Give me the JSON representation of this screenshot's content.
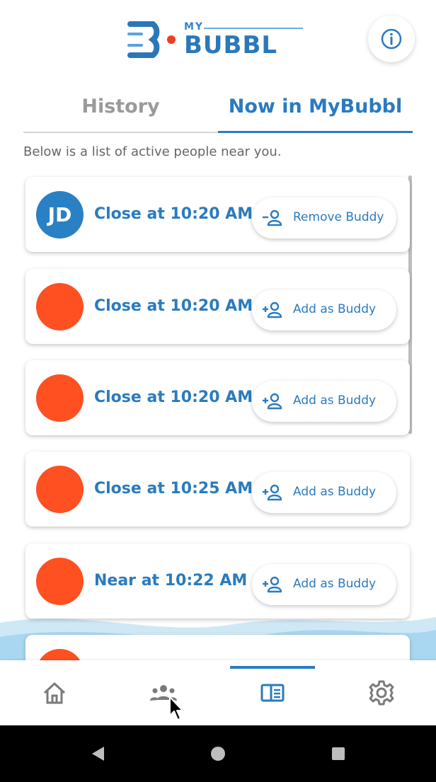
{
  "header": {
    "logo_small": "MY",
    "logo_word": "BUBBL",
    "info_icon": "info-icon"
  },
  "tabs": [
    {
      "label": "History",
      "active": false
    },
    {
      "label": "Now in MyBubbl",
      "active": true
    }
  ],
  "subtitle": "Below is a list of active people near you.",
  "people": [
    {
      "initials": "JD",
      "avatar_color": "#2a80c4",
      "status": "Close at 10:20 AM",
      "action": "Remove Buddy",
      "action_icon": "remove-person-icon"
    },
    {
      "initials": "",
      "avatar_color": "#fe5020",
      "status": "Close at 10:20 AM",
      "action": "Add as Buddy",
      "action_icon": "add-person-icon"
    },
    {
      "initials": "",
      "avatar_color": "#fe5020",
      "status": "Close at 10:20 AM",
      "action": "Add as Buddy",
      "action_icon": "add-person-icon"
    },
    {
      "initials": "",
      "avatar_color": "#fe5020",
      "status": "Close at 10:25 AM",
      "action": "Add as Buddy",
      "action_icon": "add-person-icon"
    },
    {
      "initials": "",
      "avatar_color": "#fe5020",
      "status": "Near at 10:22 AM",
      "action": "Add as Buddy",
      "action_icon": "add-person-icon"
    },
    {
      "initials": "",
      "avatar_color": "#fe5020",
      "status": "",
      "action": "",
      "action_icon": ""
    }
  ],
  "bottom_nav": [
    {
      "icon": "home-icon",
      "active": false
    },
    {
      "icon": "people-icon",
      "active": false
    },
    {
      "icon": "list-book-icon",
      "active": true
    },
    {
      "icon": "gear-icon",
      "active": false
    }
  ],
  "colors": {
    "accent": "#2a7bbf",
    "avatar_orange": "#fe5020",
    "avatar_blue": "#2a80c4"
  }
}
